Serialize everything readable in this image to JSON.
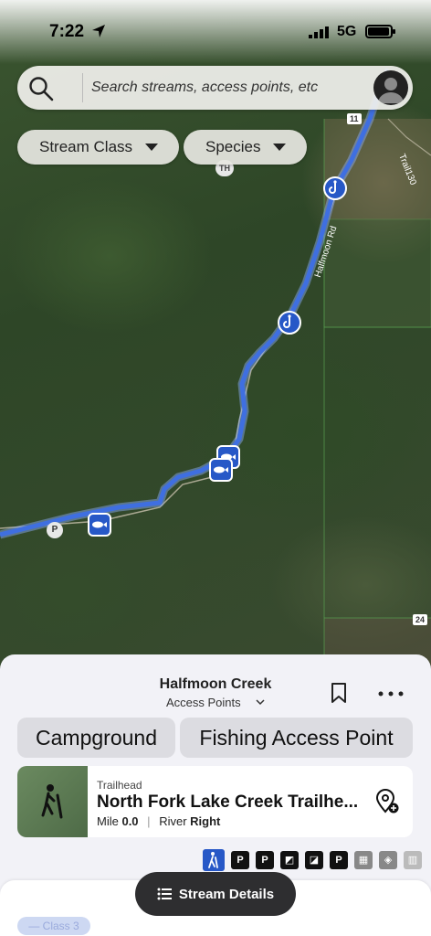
{
  "status": {
    "time": "7:22",
    "network": "5G"
  },
  "search": {
    "placeholder": "Search streams, access points, etc"
  },
  "filters": {
    "stream_class": "Stream Class",
    "species": "Species"
  },
  "map": {
    "road_label": "Halfmoon Rd",
    "trail_label": "Trail130",
    "shield_11": "11",
    "shield_24": "24",
    "th_label": "TH",
    "p_label": "P"
  },
  "sheet": {
    "title": "Halfmoon Creek",
    "subtitle": "Access Points",
    "tags": [
      "Campground",
      "Fishing Access Point"
    ],
    "card": {
      "type": "Trailhead",
      "name": "North Fork Lake Creek Trailhe...",
      "mile_label": "Mile",
      "mile_value": "0.0",
      "side_label": "River",
      "side_value": "Right"
    },
    "amenities": [
      "hiker",
      "P",
      "P",
      "restroom",
      "picnic",
      "P",
      "trash",
      "trail",
      "info"
    ]
  },
  "bottom": {
    "class_chip": "— Class 3",
    "details_button": "Stream Details"
  },
  "colors": {
    "accent": "#2758c7",
    "river": "#3f6fe0"
  }
}
